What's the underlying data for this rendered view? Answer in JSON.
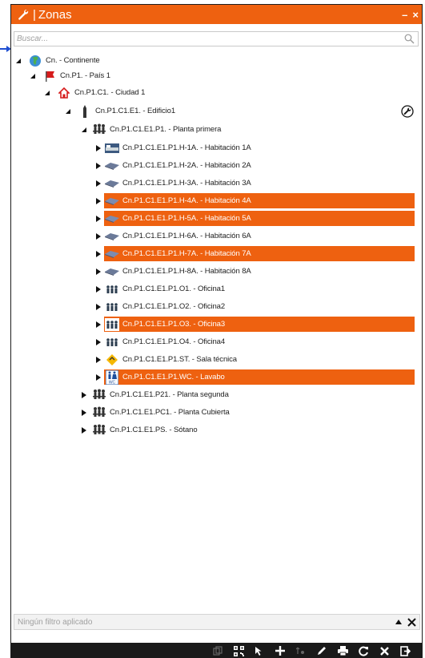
{
  "window": {
    "title": "Zonas",
    "separator": "|",
    "minimize": "–",
    "close": "×"
  },
  "search": {
    "placeholder": "Buscar..."
  },
  "tree": {
    "continente": "Cn. - Continente",
    "pais": "Cn.P1. - País 1",
    "ciudad": "Cn.P1.C1. - Ciudad 1",
    "edificio": "Cn.P1.C1.E1. - Edificio1",
    "planta1": "Cn.P1.C1.E1.P1. - Planta primera",
    "h1a": "Cn.P1.C1.E1.P1.H-1A. - Habitación 1A",
    "h2a": "Cn.P1.C1.E1.P1.H-2A. - Habitación 2A",
    "h3a": "Cn.P1.C1.E1.P1.H-3A. - Habitación 3A",
    "h4a": "Cn.P1.C1.E1.P1.H-4A. - Habitación 4A",
    "h5a": "Cn.P1.C1.E1.P1.H-5A. - Habitación 5A",
    "h6a": "Cn.P1.C1.E1.P1.H-6A. - Habitación 6A",
    "h7a": "Cn.P1.C1.E1.P1.H-7A. - Habitación 7A",
    "h8a": "Cn.P1.C1.E1.P1.H-8A. - Habitación 8A",
    "o1": "Cn.P1.C1.E1.P1.O1. - Oficina1",
    "o2": "Cn.P1.C1.E1.P1.O2. - Oficina2",
    "o3": "Cn.P1.C1.E1.P1.O3. - Oficina3",
    "o4": "Cn.P1.C1.E1.P1.O4. - Oficina4",
    "st": "Cn.P1.C1.E1.P1.ST. - Sala técnica",
    "wc": "Cn.P1.C1.E1.P1.WC. - Lavabo",
    "planta2": "Cn.P1.C1.E1.P21. - Planta segunda",
    "cubierta": "Cn.P1.C1.E1.PC1. - Planta Cubierta",
    "sotano": "Cn.P1.C1.E1.PS. - Sótano"
  },
  "filter": {
    "text": "Ningún filtro aplicado"
  },
  "colors": {
    "accent": "#ee6110",
    "toolbar": "#1a1a1a",
    "arrow": "#1f4fd1"
  },
  "icons": [
    "wrench-icon",
    "globe-icon",
    "flag-icon",
    "house-icon",
    "building-icon",
    "floor-icon",
    "bed-icon",
    "office-icon",
    "warning-icon",
    "wc-icon",
    "qr-icon",
    "pointer-icon",
    "plus-icon",
    "pen-icon",
    "print-icon",
    "refresh-icon",
    "close-icon",
    "exit-icon"
  ]
}
